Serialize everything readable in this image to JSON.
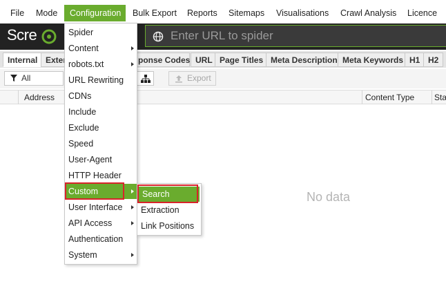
{
  "menubar": {
    "items": [
      "File",
      "Mode",
      "Configuration",
      "Bulk Export",
      "Reports",
      "Sitemaps",
      "Visualisations",
      "Crawl Analysis",
      "Licence"
    ],
    "active": "Configuration"
  },
  "header": {
    "logo_text": "Scre",
    "url_placeholder": "Enter URL to spider"
  },
  "tabs": [
    "Internal",
    "Exter",
    "ponse Codes",
    "URL",
    "Page Titles",
    "Meta Description",
    "Meta Keywords",
    "H1",
    "H2"
  ],
  "filter": {
    "selected": "All"
  },
  "export_label": "Export",
  "table": {
    "columns": [
      "Address",
      "Content Type",
      "Sta"
    ],
    "empty_text": "No data"
  },
  "config_menu": {
    "items": [
      "Spider",
      "Content",
      "robots.txt",
      "URL Rewriting",
      "CDNs",
      "Include",
      "Exclude",
      "Speed",
      "User-Agent",
      "HTTP Header",
      "Custom",
      "User Interface",
      "API Access",
      "Authentication",
      "System"
    ],
    "highlighted": "Custom"
  },
  "custom_submenu": {
    "items": [
      "Search",
      "Extraction",
      "Link Positions"
    ],
    "highlighted": "Search"
  },
  "colors": {
    "accent": "#6aac2e",
    "header_bg": "#222222",
    "annotation": "#d8232a"
  }
}
